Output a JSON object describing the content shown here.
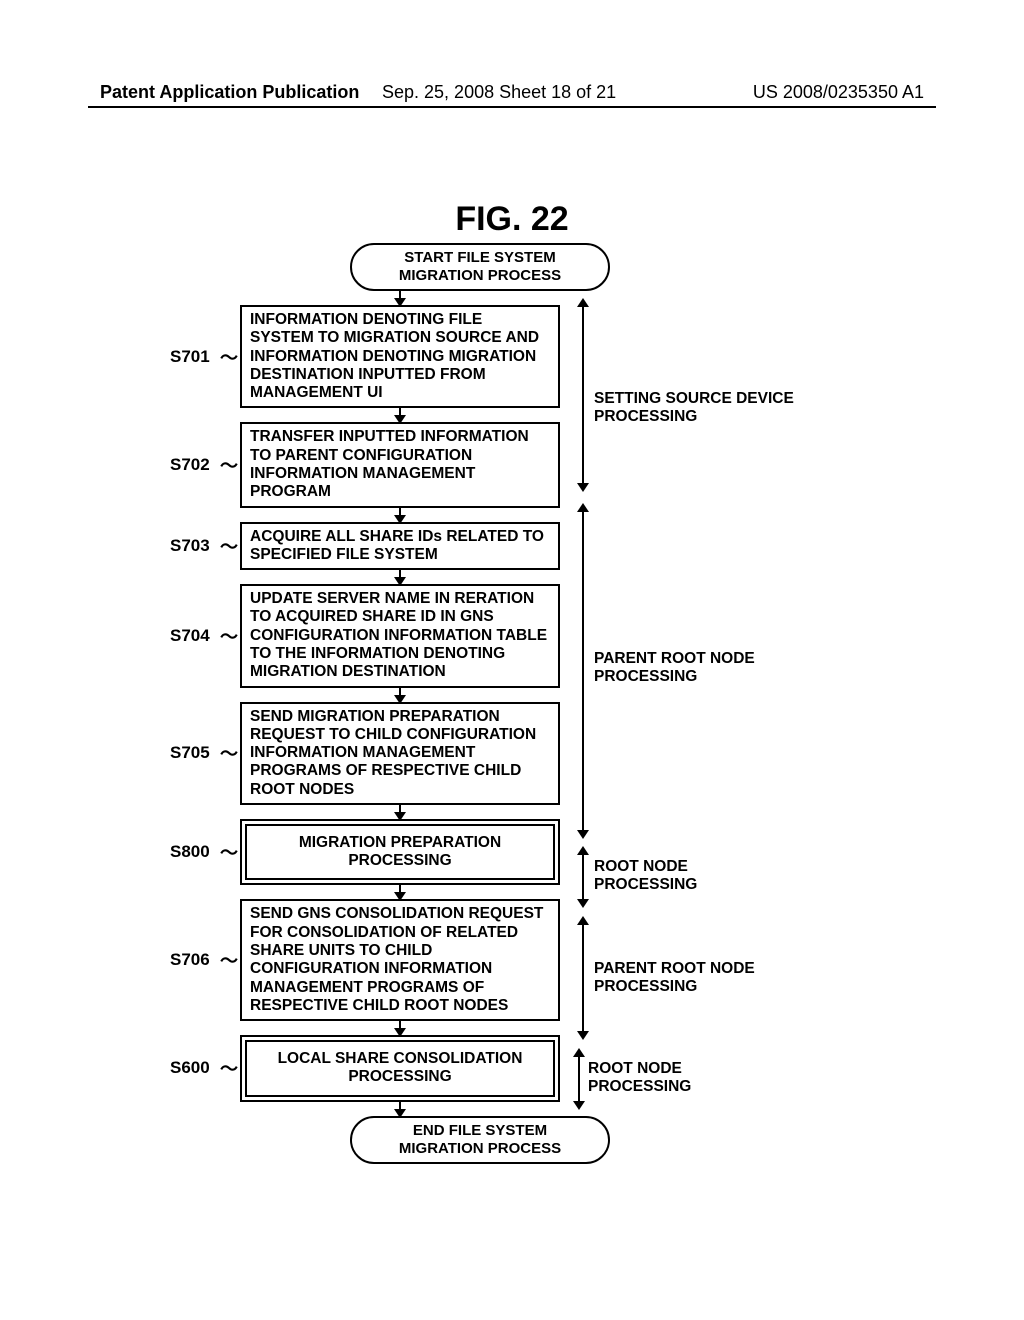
{
  "header": {
    "left": "Patent Application Publication",
    "mid": "Sep. 25, 2008  Sheet 18 of 21",
    "right": "US 2008/0235350 A1"
  },
  "figure_title": "FIG. 22",
  "terminator_start": "START FILE SYSTEM\nMIGRATION PROCESS",
  "terminator_end": "END FILE SYSTEM\nMIGRATION PROCESS",
  "steps": {
    "s701": {
      "id": "S701",
      "text": "INFORMATION DENOTING FILE SYSTEM TO  MIGRATION SOURCE AND INFORMATION DENOTING MIGRATION DESTINATION INPUTTED FROM MANAGEMENT UI"
    },
    "s702": {
      "id": "S702",
      "text": "TRANSFER INPUTTED INFORMATION TO PARENT CONFIGURATION INFORMATION MANAGEMENT PROGRAM"
    },
    "s703": {
      "id": "S703",
      "text": "ACQUIRE ALL SHARE IDs RELATED TO SPECIFIED FILE SYSTEM"
    },
    "s704": {
      "id": "S704",
      "text": "UPDATE SERVER NAME IN RERATION TO ACQUIRED SHARE ID IN GNS CONFIGURATION INFORMATION TABLE TO THE INFORMATION DENOTING MIGRATION DESTINATION"
    },
    "s705": {
      "id": "S705",
      "text": "SEND MIGRATION PREPARATION REQUEST TO CHILD CONFIGURATION INFORMATION MANAGEMENT PROGRAMS OF RESPECTIVE CHILD ROOT NODES"
    },
    "s800": {
      "id": "S800",
      "text": "MIGRATION PREPARATION PROCESSING"
    },
    "s706": {
      "id": "S706",
      "text": "SEND GNS CONSOLIDATION REQUEST FOR CONSOLIDATION OF RELATED SHARE UNITS TO CHILD CONFIGURATION INFORMATION MANAGEMENT PROGRAMS OF RESPECTIVE CHILD ROOT NODES"
    },
    "s600": {
      "id": "S600",
      "text": "LOCAL SHARE CONSOLIDATION PROCESSING"
    }
  },
  "brackets": {
    "b1": "SETTING SOURCE DEVICE PROCESSING",
    "b2": "PARENT ROOT NODE PROCESSING",
    "b3": "ROOT NODE PROCESSING",
    "b4": "PARENT ROOT NODE PROCESSING",
    "b5": "ROOT NODE PROCESSING"
  }
}
